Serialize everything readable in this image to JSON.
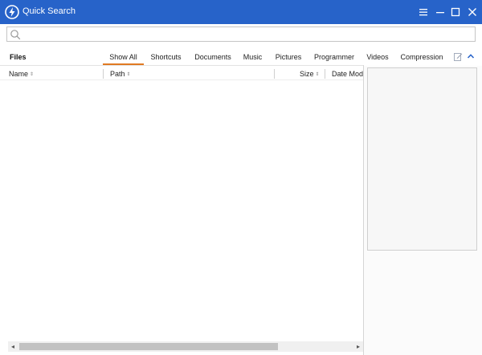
{
  "titlebar": {
    "title": "Quick Search",
    "icon": "lightning-logo-icon",
    "menu_icon": "hamburger-menu-icon",
    "minimize_icon": "minimize-icon",
    "maximize_icon": "maximize-icon",
    "close_icon": "close-icon"
  },
  "search": {
    "value": "",
    "placeholder": "",
    "icon": "search-icon"
  },
  "files": {
    "label": "Files"
  },
  "tabs": [
    {
      "label": "Show All",
      "active": true
    },
    {
      "label": "Shortcuts",
      "active": false
    },
    {
      "label": "Documents",
      "active": false
    },
    {
      "label": "Music",
      "active": false
    },
    {
      "label": "Pictures",
      "active": false
    },
    {
      "label": "Programmer",
      "active": false
    },
    {
      "label": "Videos",
      "active": false
    },
    {
      "label": "Compression",
      "active": false
    }
  ],
  "table": {
    "columns": [
      {
        "label": "Name",
        "sort_icon": "⇕"
      },
      {
        "label": "Path",
        "sort_icon": "⇕"
      },
      {
        "label": "Size",
        "sort_icon": "⇕"
      },
      {
        "label": "Date Modi",
        "sort_icon": ""
      }
    ],
    "rows": []
  },
  "scrollbar": {
    "left_arrow": "◂",
    "right_arrow": "▸"
  },
  "colors": {
    "titlebar": "#2763c9",
    "active_tab_underline": "#e07a22",
    "edit_icon": "#9aa3b5",
    "collapse_icon": "#2763c9"
  }
}
